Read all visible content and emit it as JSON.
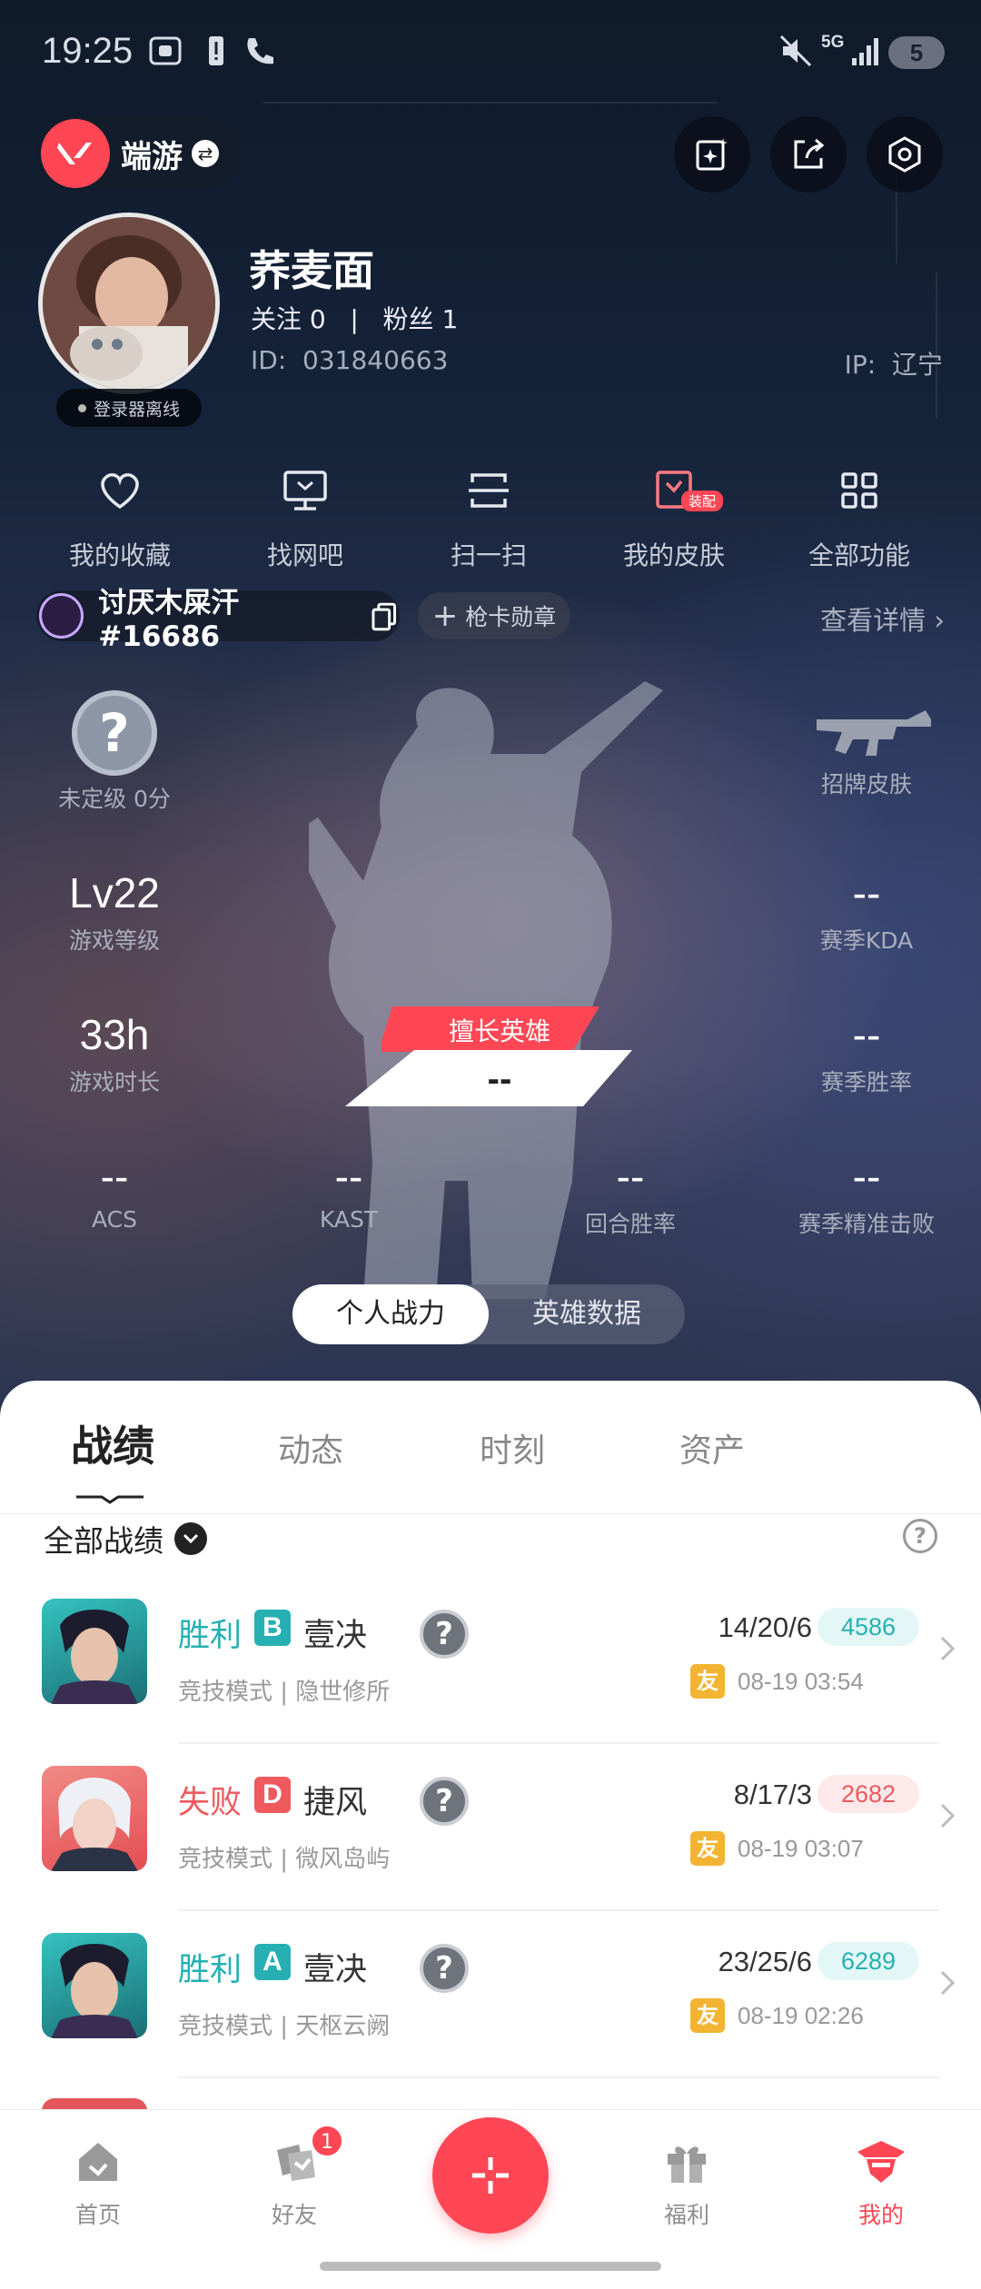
{
  "status_bar": {
    "time": "19:25",
    "net": "5G",
    "battery": "5"
  },
  "header": {
    "mode_label": "端游"
  },
  "profile": {
    "nickname": "荞麦面",
    "follow_text": "关注 0   |   粉丝 1",
    "id_text": "ID:  031840663",
    "ip_text": "IP:  辽宁",
    "login_status": "登录器离线"
  },
  "quick_actions": [
    {
      "label": "我的收藏",
      "icon": "heart-icon"
    },
    {
      "label": "找网吧",
      "icon": "monitor-icon"
    },
    {
      "label": "扫一扫",
      "icon": "scan-icon"
    },
    {
      "label": "我的皮肤",
      "icon": "skin-icon",
      "tag": "装配"
    },
    {
      "label": "全部功能",
      "icon": "grid-icon"
    }
  ],
  "game_account": {
    "riot_id": "讨厌木屎汗#16686",
    "card_button": "枪卡勋章",
    "detail_link": "查看详情"
  },
  "stats": {
    "rank": {
      "icon_text": "?",
      "label": "未定级 0分"
    },
    "featured_skin_label": "招牌皮肤",
    "level": {
      "value": "Lv22",
      "label": "游戏等级"
    },
    "kda": {
      "value": "--",
      "label": "赛季KDA"
    },
    "playtime": {
      "value": "33h",
      "label": "游戏时长"
    },
    "winrate": {
      "value": "--",
      "label": "赛季胜率"
    },
    "hero": {
      "title": "擅长英雄",
      "value": "--"
    },
    "acs": {
      "value": "--",
      "label": "ACS"
    },
    "kast": {
      "value": "--",
      "label": "KAST"
    },
    "round_winrate": {
      "value": "--",
      "label": "回合胜率"
    },
    "headshot": {
      "value": "--",
      "label": "赛季精准击败"
    }
  },
  "toggle": {
    "left": "个人战力",
    "right": "英雄数据"
  },
  "tabs": [
    "战绩",
    "动态",
    "时刻",
    "资产"
  ],
  "filter_label": "全部战绩",
  "matches": [
    {
      "result": "胜利",
      "grade": "B",
      "hero": "壹决",
      "mode": "竞技模式 | 隐世修所",
      "kda": "14/20/6",
      "score": "4586",
      "friend": "友",
      "date": "08-19 03:54"
    },
    {
      "result": "失败",
      "grade": "D",
      "hero": "捷风",
      "mode": "竞技模式 | 微风岛屿",
      "kda": "8/17/3",
      "score": "2682",
      "friend": "友",
      "date": "08-19 03:07"
    },
    {
      "result": "胜利",
      "grade": "A",
      "hero": "壹决",
      "mode": "竞技模式 | 天枢云阙",
      "kda": "23/25/6",
      "score": "6289",
      "friend": "友",
      "date": "08-19 02:26"
    }
  ],
  "colors": {
    "win": "#26b0b3",
    "lose": "#ee5a5e",
    "accent": "#ff4655"
  },
  "bottom_nav": [
    {
      "label": "首页",
      "icon": "home-icon"
    },
    {
      "label": "好友",
      "icon": "friends-icon",
      "badge": "1"
    },
    {
      "label": "福利",
      "icon": "gift-icon"
    },
    {
      "label": "我的",
      "icon": "profile-icon"
    }
  ]
}
